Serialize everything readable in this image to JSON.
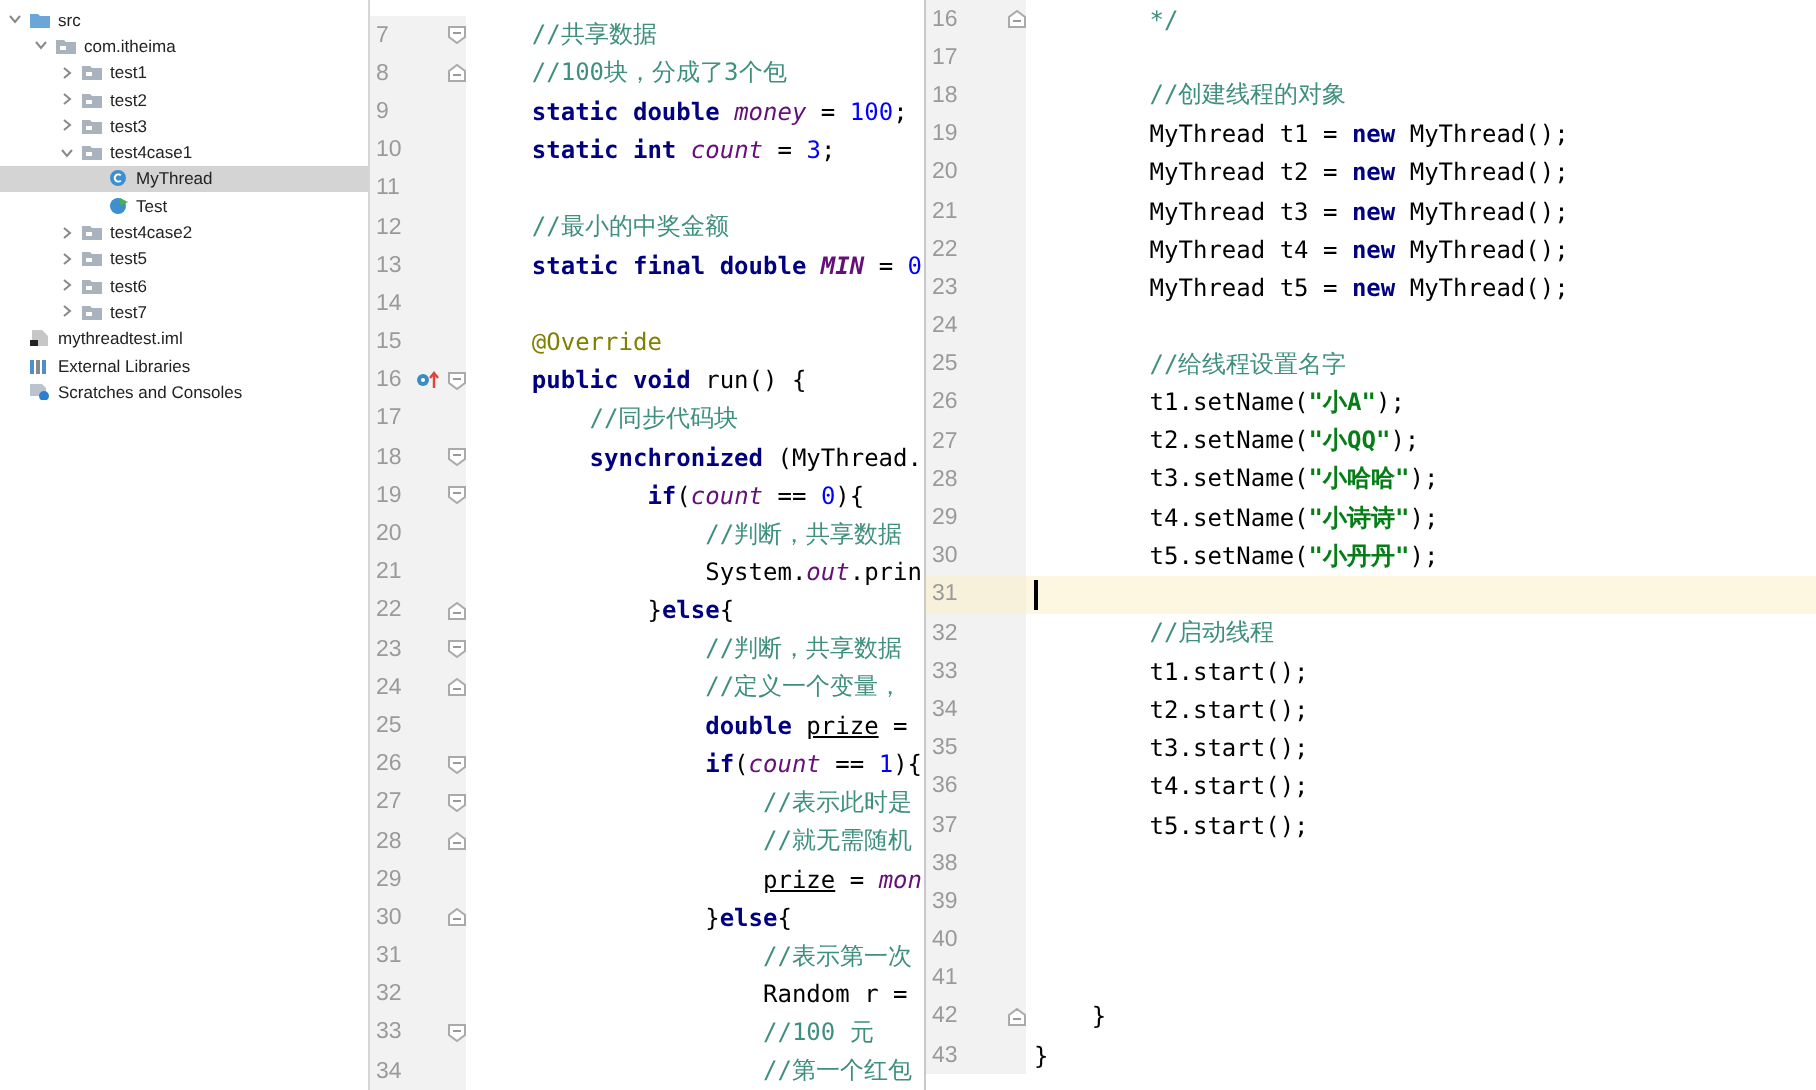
{
  "project_tree": {
    "items": [
      {
        "label": "src",
        "kind": "source-folder",
        "expanded": true,
        "selected": false,
        "children": [
          {
            "label": "com.itheima",
            "kind": "package",
            "expanded": true,
            "selected": false,
            "children": [
              {
                "label": "test1",
                "kind": "package",
                "expanded": false,
                "selected": false
              },
              {
                "label": "test2",
                "kind": "package",
                "expanded": false,
                "selected": false
              },
              {
                "label": "test3",
                "kind": "package",
                "expanded": false,
                "selected": false
              },
              {
                "label": "test4case1",
                "kind": "package",
                "expanded": true,
                "selected": false,
                "children": [
                  {
                    "label": "MyThread",
                    "kind": "class",
                    "selected": true
                  },
                  {
                    "label": "Test",
                    "kind": "main-class",
                    "selected": false
                  }
                ]
              },
              {
                "label": "test4case2",
                "kind": "package",
                "expanded": false,
                "selected": false
              },
              {
                "label": "test5",
                "kind": "package",
                "expanded": false,
                "selected": false
              },
              {
                "label": "test6",
                "kind": "package",
                "expanded": false,
                "selected": false
              },
              {
                "label": "test7",
                "kind": "package",
                "expanded": false,
                "selected": false
              }
            ]
          }
        ]
      },
      {
        "label": "mythreadtest.iml",
        "kind": "module-file",
        "selected": false
      },
      {
        "label": "External Libraries",
        "kind": "libraries",
        "selected": false
      },
      {
        "label": "Scratches and Consoles",
        "kind": "scratches",
        "selected": false
      }
    ]
  },
  "editors": [
    {
      "lines": [
        {
          "number": "7",
          "gutter_icons": [
            {
              "kind": "fold-start"
            }
          ],
          "current": false,
          "code": [
            {
              "text": "    //共享数据",
              "kind": "comment"
            }
          ]
        },
        {
          "number": "8",
          "gutter_icons": [
            {
              "kind": "fold-end"
            }
          ],
          "current": false,
          "code": [
            {
              "text": "    //100块，分成了3个包",
              "kind": "comment"
            }
          ]
        },
        {
          "number": "9",
          "current": false,
          "code": [
            {
              "text": "    static double ",
              "kind": "keyword"
            },
            {
              "text": "money",
              "kind": "field"
            },
            {
              "text": " = ",
              "kind": "plain"
            },
            {
              "text": "100",
              "kind": "number"
            },
            {
              "text": ";",
              "kind": "plain"
            }
          ]
        },
        {
          "number": "10",
          "current": false,
          "code": [
            {
              "text": "    static int ",
              "kind": "keyword"
            },
            {
              "text": "count",
              "kind": "field"
            },
            {
              "text": " = ",
              "kind": "plain"
            },
            {
              "text": "3",
              "kind": "number"
            },
            {
              "text": ";",
              "kind": "plain"
            }
          ]
        },
        {
          "number": "11",
          "current": false
        },
        {
          "number": "12",
          "current": false,
          "code": [
            {
              "text": "    //最小的中奖金额",
              "kind": "comment"
            }
          ]
        },
        {
          "number": "13",
          "current": false,
          "code": [
            {
              "text": "    static final double ",
              "kind": "keyword"
            },
            {
              "text": "MIN",
              "kind": "constant"
            },
            {
              "text": " = ",
              "kind": "plain"
            },
            {
              "text": "0",
              "kind": "number"
            }
          ]
        },
        {
          "number": "14",
          "current": false
        },
        {
          "number": "15",
          "current": false,
          "code": [
            {
              "text": "    @Override",
              "kind": "annotation"
            }
          ]
        },
        {
          "number": "16",
          "gutter_icons": [
            {
              "kind": "override"
            },
            {
              "kind": "fold-start"
            }
          ],
          "current": false,
          "code": [
            {
              "text": "    public void ",
              "kind": "keyword"
            },
            {
              "text": "run() {",
              "kind": "plain"
            }
          ]
        },
        {
          "number": "17",
          "current": false,
          "code": [
            {
              "text": "        //同步代码块",
              "kind": "comment"
            }
          ]
        },
        {
          "number": "18",
          "gutter_icons": [
            {
              "kind": "fold-start"
            }
          ],
          "current": false,
          "code": [
            {
              "text": "        synchronized ",
              "kind": "keyword"
            },
            {
              "text": "(MyThread.",
              "kind": "plain"
            }
          ]
        },
        {
          "number": "19",
          "gutter_icons": [
            {
              "kind": "fold-start"
            }
          ],
          "current": false,
          "code": [
            {
              "text": "            if",
              "kind": "keyword"
            },
            {
              "text": "(",
              "kind": "plain"
            },
            {
              "text": "count",
              "kind": "field"
            },
            {
              "text": " == ",
              "kind": "plain"
            },
            {
              "text": "0",
              "kind": "number"
            },
            {
              "text": "){",
              "kind": "plain"
            }
          ]
        },
        {
          "number": "20",
          "current": false,
          "code": [
            {
              "text": "                //判断，共享数据",
              "kind": "comment"
            }
          ]
        },
        {
          "number": "21",
          "current": false,
          "code": [
            {
              "text": "                System.",
              "kind": "plain"
            },
            {
              "text": "out",
              "kind": "field"
            },
            {
              "text": ".prin",
              "kind": "plain"
            }
          ]
        },
        {
          "number": "22",
          "gutter_icons": [
            {
              "kind": "fold-end"
            }
          ],
          "current": false,
          "code": [
            {
              "text": "            }",
              "kind": "plain"
            },
            {
              "text": "else",
              "kind": "keyword"
            },
            {
              "text": "{",
              "kind": "plain"
            }
          ]
        },
        {
          "number": "23",
          "gutter_icons": [
            {
              "kind": "fold-start"
            }
          ],
          "current": false,
          "code": [
            {
              "text": "                //判断，共享数据",
              "kind": "comment"
            }
          ]
        },
        {
          "number": "24",
          "gutter_icons": [
            {
              "kind": "fold-end"
            }
          ],
          "current": false,
          "code": [
            {
              "text": "                //定义一个变量，",
              "kind": "comment"
            }
          ]
        },
        {
          "number": "25",
          "current": false,
          "code": [
            {
              "text": "                double ",
              "kind": "keyword"
            },
            {
              "text": "prize",
              "kind": "local"
            },
            {
              "text": " =",
              "kind": "plain"
            }
          ]
        },
        {
          "number": "26",
          "gutter_icons": [
            {
              "kind": "fold-start"
            }
          ],
          "current": false,
          "code": [
            {
              "text": "                if",
              "kind": "keyword"
            },
            {
              "text": "(",
              "kind": "plain"
            },
            {
              "text": "count",
              "kind": "field"
            },
            {
              "text": " == ",
              "kind": "plain"
            },
            {
              "text": "1",
              "kind": "number"
            },
            {
              "text": "){",
              "kind": "plain"
            }
          ]
        },
        {
          "number": "27",
          "gutter_icons": [
            {
              "kind": "fold-start"
            }
          ],
          "current": false,
          "code": [
            {
              "text": "                    //表示此时是",
              "kind": "comment"
            }
          ]
        },
        {
          "number": "28",
          "gutter_icons": [
            {
              "kind": "fold-end"
            }
          ],
          "current": false,
          "code": [
            {
              "text": "                    //就无需随机",
              "kind": "comment"
            }
          ]
        },
        {
          "number": "29",
          "current": false,
          "code": [
            {
              "text": "                    prize",
              "kind": "local"
            },
            {
              "text": " = ",
              "kind": "plain"
            },
            {
              "text": "mon",
              "kind": "field"
            }
          ]
        },
        {
          "number": "30",
          "gutter_icons": [
            {
              "kind": "fold-end"
            }
          ],
          "current": false,
          "code": [
            {
              "text": "                }",
              "kind": "plain"
            },
            {
              "text": "else",
              "kind": "keyword"
            },
            {
              "text": "{",
              "kind": "plain"
            }
          ]
        },
        {
          "number": "31",
          "current": false,
          "code": [
            {
              "text": "                    //表示第一次",
              "kind": "comment"
            }
          ]
        },
        {
          "number": "32",
          "current": false,
          "code": [
            {
              "text": "                    Random r =",
              "kind": "plain"
            }
          ]
        },
        {
          "number": "33",
          "gutter_icons": [
            {
              "kind": "fold-start"
            }
          ],
          "current": false,
          "code": [
            {
              "text": "                    //100 元",
              "kind": "comment"
            }
          ]
        },
        {
          "number": "34",
          "current": false,
          "code": [
            {
              "text": "                    //第一个红包",
              "kind": "comment"
            }
          ]
        }
      ]
    },
    {
      "lines": [
        {
          "number": "16",
          "gutter_icons": [
            {
              "kind": "fold-end"
            }
          ],
          "current": false,
          "code": [
            {
              "text": "        */",
              "kind": "comment"
            }
          ]
        },
        {
          "number": "17",
          "current": false
        },
        {
          "number": "18",
          "current": false,
          "code": [
            {
              "text": "        //创建线程的对象",
              "kind": "comment"
            }
          ]
        },
        {
          "number": "19",
          "current": false,
          "code": [
            {
              "text": "        MyThread t1 = ",
              "kind": "plain"
            },
            {
              "text": "new ",
              "kind": "keyword"
            },
            {
              "text": "MyThread();",
              "kind": "plain"
            }
          ]
        },
        {
          "number": "20",
          "current": false,
          "code": [
            {
              "text": "        MyThread t2 = ",
              "kind": "plain"
            },
            {
              "text": "new ",
              "kind": "keyword"
            },
            {
              "text": "MyThread();",
              "kind": "plain"
            }
          ]
        },
        {
          "number": "21",
          "current": false,
          "code": [
            {
              "text": "        MyThread t3 = ",
              "kind": "plain"
            },
            {
              "text": "new ",
              "kind": "keyword"
            },
            {
              "text": "MyThread();",
              "kind": "plain"
            }
          ]
        },
        {
          "number": "22",
          "current": false,
          "code": [
            {
              "text": "        MyThread t4 = ",
              "kind": "plain"
            },
            {
              "text": "new ",
              "kind": "keyword"
            },
            {
              "text": "MyThread();",
              "kind": "plain"
            }
          ]
        },
        {
          "number": "23",
          "current": false,
          "code": [
            {
              "text": "        MyThread t5 = ",
              "kind": "plain"
            },
            {
              "text": "new ",
              "kind": "keyword"
            },
            {
              "text": "MyThread();",
              "kind": "plain"
            }
          ]
        },
        {
          "number": "24",
          "current": false
        },
        {
          "number": "25",
          "current": false,
          "code": [
            {
              "text": "        //给线程设置名字",
              "kind": "comment"
            }
          ]
        },
        {
          "number": "26",
          "current": false,
          "code": [
            {
              "text": "        t1.setName(",
              "kind": "plain"
            },
            {
              "text": "\"小A\"",
              "kind": "string"
            },
            {
              "text": ");",
              "kind": "plain"
            }
          ]
        },
        {
          "number": "27",
          "current": false,
          "code": [
            {
              "text": "        t2.setName(",
              "kind": "plain"
            },
            {
              "text": "\"小QQ\"",
              "kind": "string"
            },
            {
              "text": ");",
              "kind": "plain"
            }
          ]
        },
        {
          "number": "28",
          "current": false,
          "code": [
            {
              "text": "        t3.setName(",
              "kind": "plain"
            },
            {
              "text": "\"小哈哈\"",
              "kind": "string"
            },
            {
              "text": ");",
              "kind": "plain"
            }
          ]
        },
        {
          "number": "29",
          "current": false,
          "code": [
            {
              "text": "        t4.setName(",
              "kind": "plain"
            },
            {
              "text": "\"小诗诗\"",
              "kind": "string"
            },
            {
              "text": ");",
              "kind": "plain"
            }
          ]
        },
        {
          "number": "30",
          "current": false,
          "code": [
            {
              "text": "        t5.setName(",
              "kind": "plain"
            },
            {
              "text": "\"小丹丹\"",
              "kind": "string"
            },
            {
              "text": ");",
              "kind": "plain"
            }
          ]
        },
        {
          "number": "31",
          "current": true
        },
        {
          "number": "32",
          "current": false,
          "code": [
            {
              "text": "        //启动线程",
              "kind": "comment"
            }
          ]
        },
        {
          "number": "33",
          "current": false,
          "code": [
            {
              "text": "        t1.start();",
              "kind": "plain"
            }
          ]
        },
        {
          "number": "34",
          "current": false,
          "code": [
            {
              "text": "        t2.start();",
              "kind": "plain"
            }
          ]
        },
        {
          "number": "35",
          "current": false,
          "code": [
            {
              "text": "        t3.start();",
              "kind": "plain"
            }
          ]
        },
        {
          "number": "36",
          "current": false,
          "code": [
            {
              "text": "        t4.start();",
              "kind": "plain"
            }
          ]
        },
        {
          "number": "37",
          "current": false,
          "code": [
            {
              "text": "        t5.start();",
              "kind": "plain"
            }
          ]
        },
        {
          "number": "38",
          "current": false
        },
        {
          "number": "39",
          "current": false
        },
        {
          "number": "40",
          "current": false
        },
        {
          "number": "41",
          "current": false
        },
        {
          "number": "42",
          "gutter_icons": [
            {
              "kind": "fold-end"
            }
          ],
          "current": false,
          "code": [
            {
              "text": "    }",
              "kind": "plain"
            }
          ]
        },
        {
          "number": "43",
          "current": false,
          "code": [
            {
              "text": "}",
              "kind": "plain"
            }
          ]
        }
      ]
    }
  ]
}
